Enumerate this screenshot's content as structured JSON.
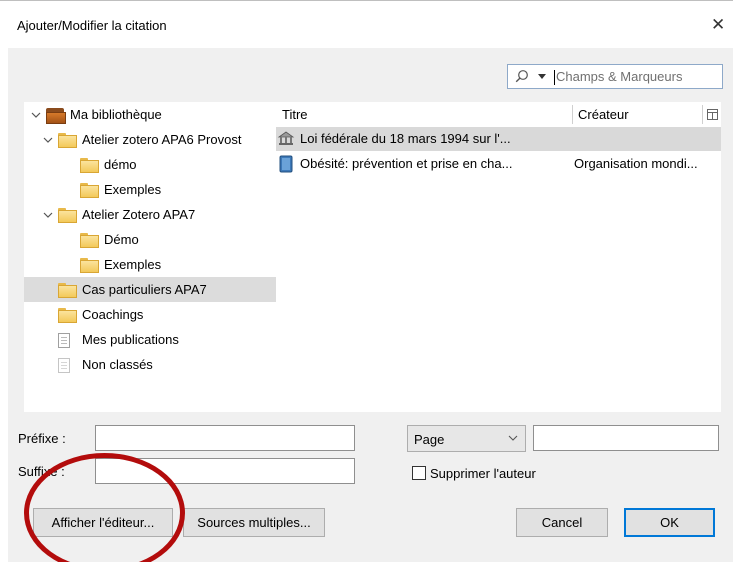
{
  "window": {
    "title": "Ajouter/Modifier la citation",
    "close_glyph": "✕"
  },
  "search": {
    "placeholder": "Champs & Marqueurs"
  },
  "collections": [
    {
      "label": "Ma bibliothèque",
      "icon": "library-icon",
      "level": 0,
      "expanded": true
    },
    {
      "label": "Atelier zotero APA6 Provost",
      "icon": "folder-icon",
      "level": 1,
      "expanded": true
    },
    {
      "label": "démo",
      "icon": "folder-icon",
      "level": 2
    },
    {
      "label": "Exemples",
      "icon": "folder-icon",
      "level": 2
    },
    {
      "label": "Atelier Zotero APA7",
      "icon": "folder-icon",
      "level": 1,
      "expanded": true
    },
    {
      "label": "Démo",
      "icon": "folder-icon",
      "level": 2
    },
    {
      "label": "Exemples",
      "icon": "folder-icon",
      "level": 2
    },
    {
      "label": "Cas particuliers APA7",
      "icon": "folder-icon",
      "level": 1,
      "selected": true
    },
    {
      "label": "Coachings",
      "icon": "folder-icon",
      "level": 1
    },
    {
      "label": "Mes publications",
      "icon": "document-icon",
      "level": 1
    },
    {
      "label": "Non classés",
      "icon": "unfiled-icon",
      "level": 1
    }
  ],
  "items": {
    "columns": {
      "title": "Titre",
      "creator": "Créateur"
    },
    "rows": [
      {
        "title": "Loi fédérale du 18 mars 1994 sur l'...",
        "creator": "",
        "icon": "statute-icon",
        "selected": true
      },
      {
        "title": "Obésité: prévention et prise en cha...",
        "creator": "Organisation mondi...",
        "icon": "book-icon"
      }
    ]
  },
  "form": {
    "prefix_label": "Préfixe :",
    "suffix_label": "Suffixe :",
    "prefix_value": "",
    "suffix_value": "",
    "locator_type": "Page",
    "locator_value": "",
    "suppress_author_label": "Supprimer l'auteur",
    "suppress_author_checked": false
  },
  "buttons": {
    "show_editor": "Afficher l'éditeur...",
    "multiple_sources": "Sources multiples...",
    "cancel": "Cancel",
    "ok": "OK"
  },
  "colors": {
    "annotation": "#b30c0c",
    "folder": "#f3c95a",
    "selection": "#dcdcdc",
    "default_button_border": "#0078d7"
  }
}
